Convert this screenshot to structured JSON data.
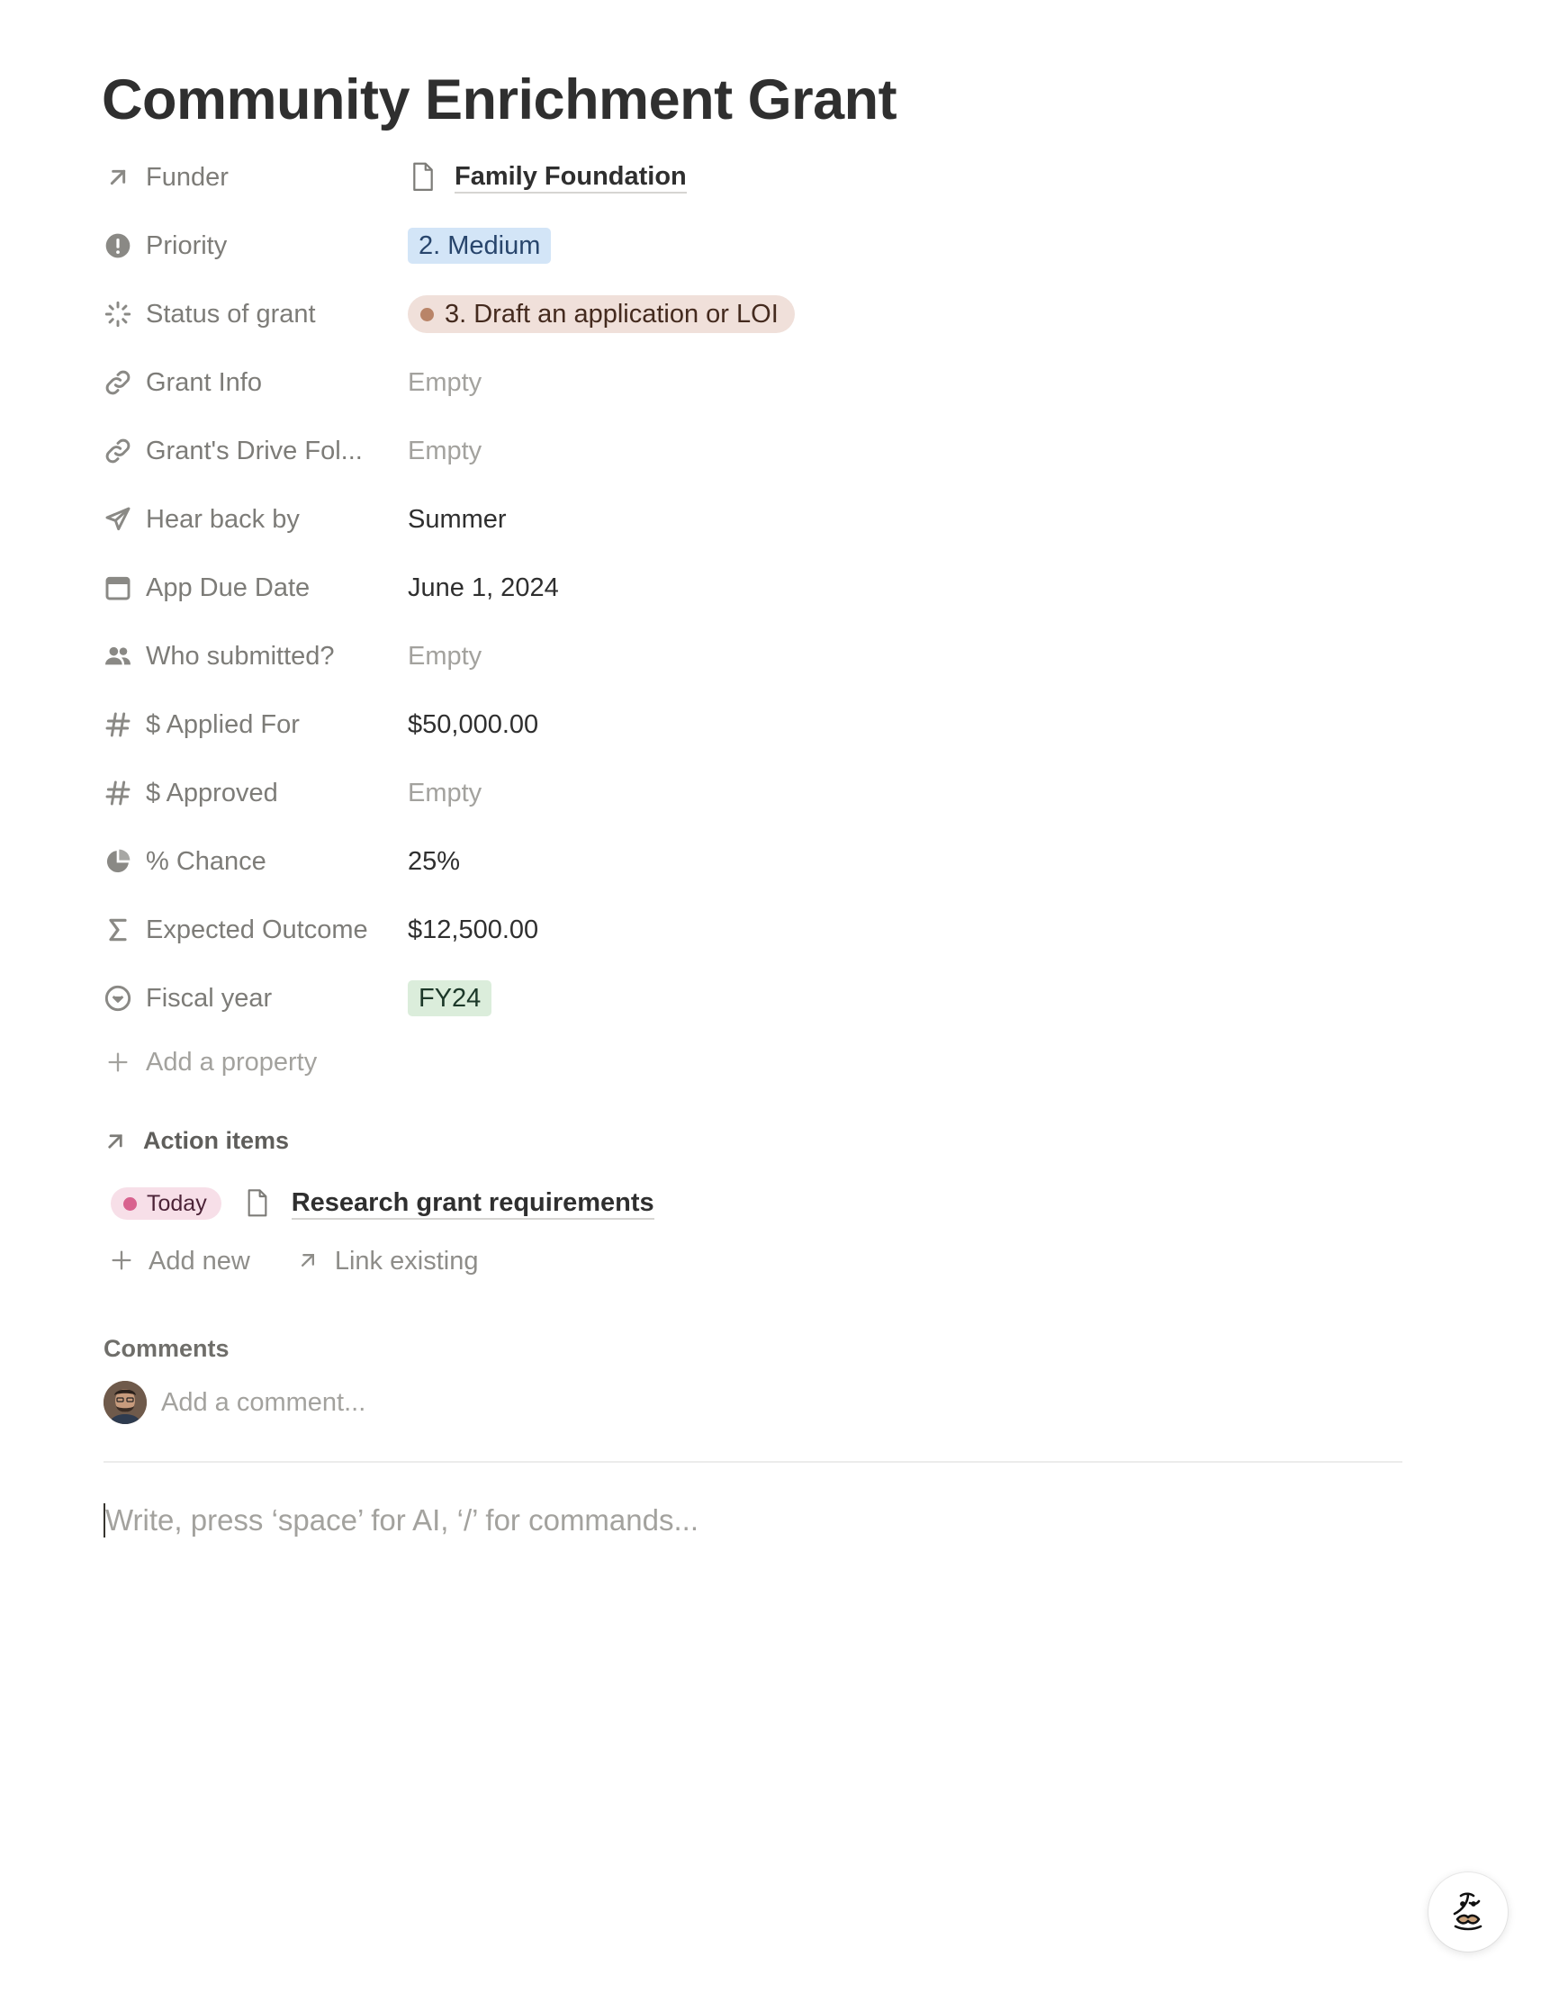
{
  "page": {
    "title": "Community Enrichment Grant"
  },
  "properties": [
    {
      "name": "Funder",
      "icon": "relation-arrow-icon",
      "value": "Family Foundation",
      "kind": "relation"
    },
    {
      "name": "Priority",
      "icon": "exclamation-circle-icon",
      "value": "2. Medium",
      "kind": "select",
      "color": "#d3e5f7"
    },
    {
      "name": "Status of grant",
      "icon": "status-spinner-icon",
      "value": "3. Draft an application or LOI",
      "kind": "status",
      "color": "#f0e0da"
    },
    {
      "name": "Grant Info",
      "icon": "link-icon",
      "value": "Empty",
      "kind": "empty"
    },
    {
      "name": "Grant's Drive Fol...",
      "icon": "link-icon",
      "value": "Empty",
      "kind": "empty"
    },
    {
      "name": "Hear back by",
      "icon": "paper-plane-icon",
      "value": "Summer",
      "kind": "text"
    },
    {
      "name": "App Due Date",
      "icon": "calendar-icon",
      "value": "June 1, 2024",
      "kind": "date"
    },
    {
      "name": "Who submitted?",
      "icon": "people-icon",
      "value": "Empty",
      "kind": "empty"
    },
    {
      "name": "$ Applied For",
      "icon": "hash-icon",
      "value": "$50,000.00",
      "kind": "number"
    },
    {
      "name": "$ Approved",
      "icon": "hash-icon",
      "value": "Empty",
      "kind": "empty"
    },
    {
      "name": "% Chance",
      "icon": "pie-chart-icon",
      "value": "25%",
      "kind": "number"
    },
    {
      "name": "Expected Outcome",
      "icon": "sigma-icon",
      "value": "$12,500.00",
      "kind": "formula"
    },
    {
      "name": "Fiscal year",
      "icon": "select-circle-icon",
      "value": "FY24",
      "kind": "select",
      "color": "#dbeddb"
    }
  ],
  "add_property": {
    "label": "Add a property"
  },
  "action_items": {
    "heading": "Action items",
    "items": [
      {
        "due": "Today",
        "title": "Research grant requirements"
      }
    ],
    "add_new_label": "Add new",
    "link_existing_label": "Link existing"
  },
  "comments": {
    "label": "Comments",
    "placeholder": "Add a comment..."
  },
  "editor": {
    "placeholder": "Write, press ‘space’ for AI, ‘/’ for commands..."
  },
  "help_button": {
    "icon": "notion-face-icon"
  }
}
